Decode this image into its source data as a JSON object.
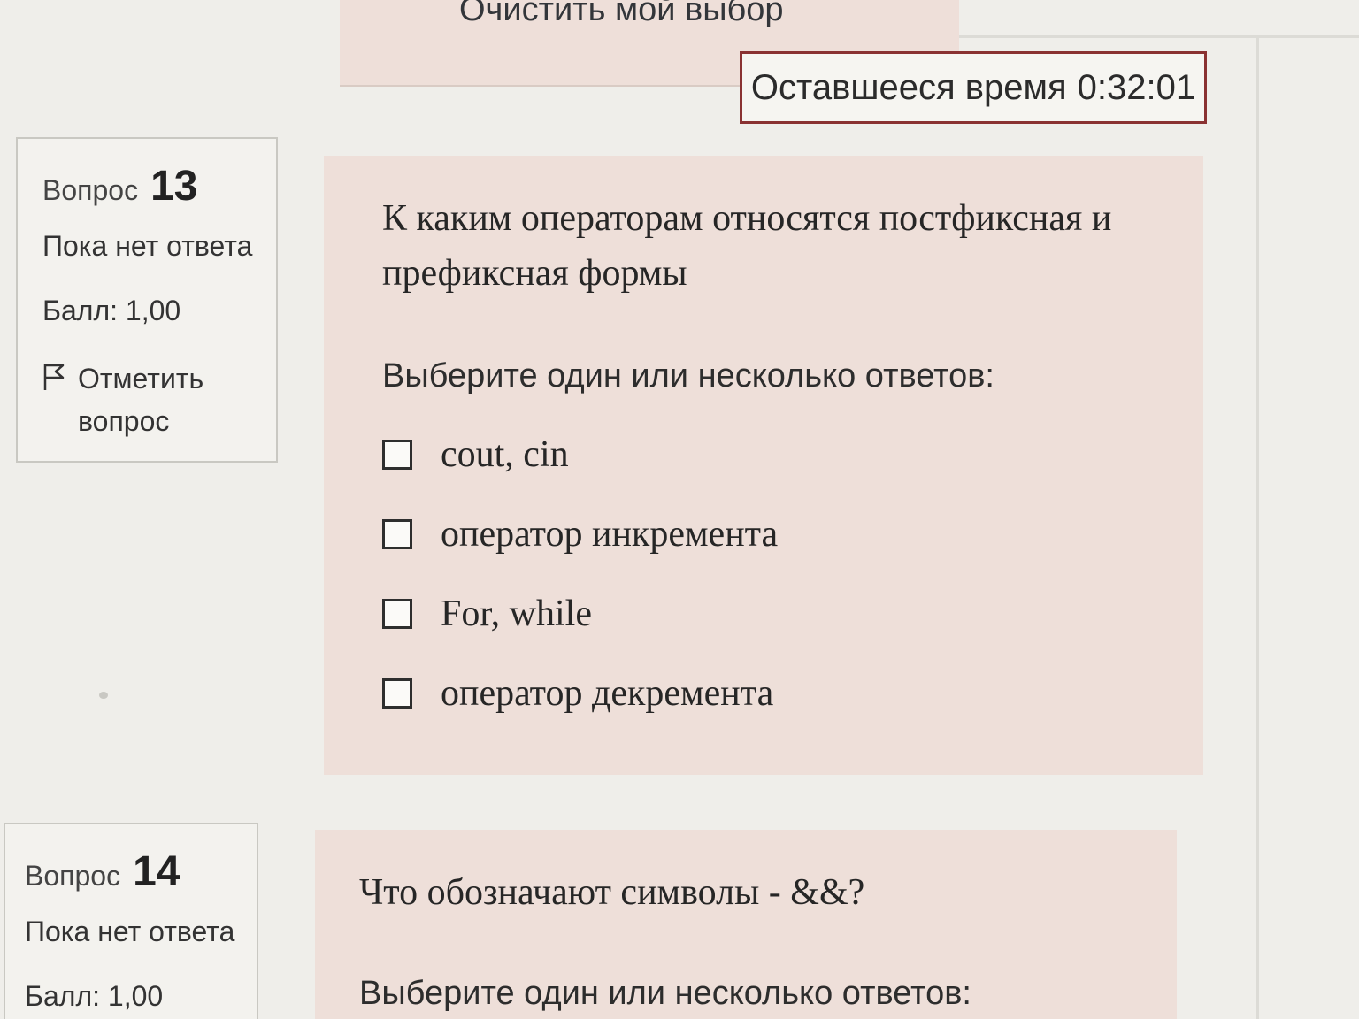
{
  "top": {
    "clear_choice_label": "Очистить мой выбор",
    "timer_label": "Оставшееся время",
    "timer_value": "0:32:01"
  },
  "questions": [
    {
      "label": "Вопрос",
      "number": "13",
      "state": "Пока нет ответа",
      "grade": "Балл: 1,00",
      "flag_label": "Отметить вопрос",
      "text": "К каким операторам относятся постфиксная и префиксная формы",
      "prompt": "Выберите один или несколько ответов:",
      "answers": [
        {
          "label": "cout, cin",
          "checked": false
        },
        {
          "label": "оператор инкремента",
          "checked": false
        },
        {
          "label": "For, while",
          "checked": false
        },
        {
          "label": "оператор декремента",
          "checked": false
        }
      ]
    },
    {
      "label": "Вопрос",
      "number": "14",
      "state": "Пока нет ответа",
      "grade": "Балл: 1,00",
      "text": "Что обозначают символы - &&?",
      "prompt": "Выберите один или несколько ответов:"
    }
  ],
  "colors": {
    "page_bg": "#efeeea",
    "question_bg": "#eedfd9",
    "timer_border": "#8a3232"
  },
  "icons": {
    "flag": "flag-icon",
    "checkbox": "checkbox-icon"
  }
}
